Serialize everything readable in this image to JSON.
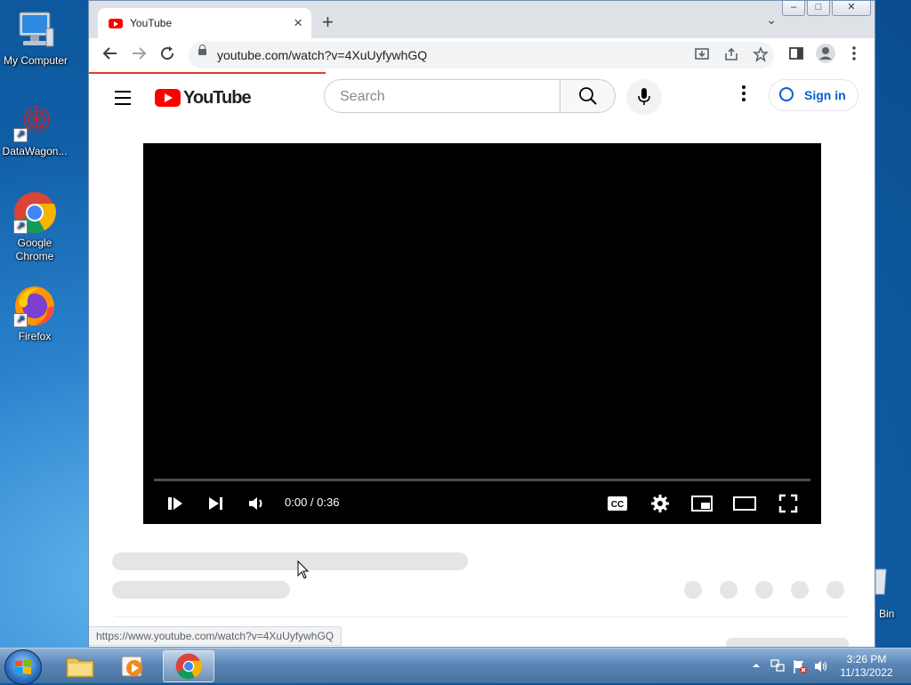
{
  "desktop": {
    "icons": [
      {
        "label": "My Computer"
      },
      {
        "label": "DataWagon..."
      },
      {
        "label": "Google Chrome"
      },
      {
        "label": "Firefox"
      }
    ],
    "recycle_partial": "Bin"
  },
  "browser": {
    "tab_title": "YouTube",
    "tab_close": "×",
    "new_tab": "+",
    "tab_menu": "⌄",
    "url": "youtube.com/watch?v=4XuUyfywhGQ",
    "status_url": "https://www.youtube.com/watch?v=4XuUyfywhGQ",
    "window_buttons": {
      "minimize": "–",
      "maximize": "□",
      "close": "✕"
    }
  },
  "youtube": {
    "logo_text": "YouTube",
    "search_placeholder": "Search",
    "sign_in": "Sign in",
    "player": {
      "time": "0:00 / 0:36",
      "cc_label": "CC",
      "progress": 0
    }
  },
  "taskbar": {
    "clock_time": "3:26 PM",
    "clock_date": "11/13/2022"
  }
}
